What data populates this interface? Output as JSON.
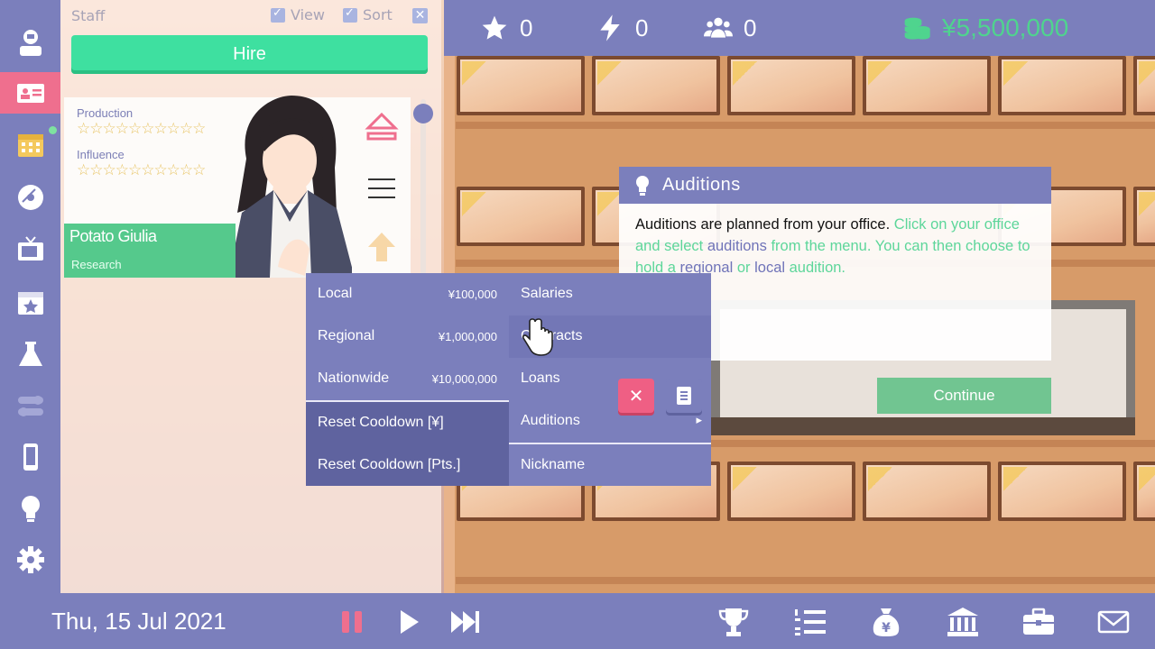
{
  "staff_panel": {
    "title": "Staff",
    "view_label": "View",
    "sort_label": "Sort",
    "close_glyph": "✕",
    "hire_label": "Hire"
  },
  "staff_card": {
    "production_label": "Production",
    "production_stars": "☆☆☆☆☆☆☆☆☆☆",
    "influence_label": "Influence",
    "influence_stars": "☆☆☆☆☆☆☆☆☆☆",
    "name": "Potato Giulia",
    "role": "Research"
  },
  "topbar": {
    "stars": "0",
    "energy": "0",
    "fans": "0",
    "money": "¥5,500,000"
  },
  "audition_menu": {
    "items": [
      {
        "label": "Local",
        "price": "¥100,000"
      },
      {
        "label": "Regional",
        "price": "¥1,000,000"
      },
      {
        "label": "Nationwide",
        "price": "¥10,000,000"
      },
      {
        "label": "Reset Cooldown [¥]"
      },
      {
        "label": "Reset Cooldown [Pts.]"
      }
    ]
  },
  "context_menu": {
    "items": [
      {
        "label": "Salaries"
      },
      {
        "label": "Contracts"
      },
      {
        "label": "Loans"
      },
      {
        "label": "Auditions",
        "arrow": "▸"
      },
      {
        "label": "Nickname"
      }
    ]
  },
  "dialog": {
    "title": "Auditions",
    "text_1": "Auditions are planned from your office.",
    "text_2": " Click on your office and select ",
    "text_3": "auditions",
    "text_4": " from the menu. You can then choose to hold a ",
    "text_5": "regional",
    "text_6": " or ",
    "text_7": "local",
    "text_8": " audition.",
    "continue_label": "Continue",
    "close_glyph": "✕"
  },
  "bottombar": {
    "date": "Thu, 15 Jul 2021"
  },
  "colors": {
    "bar": "#7b7fbc",
    "accent_pink": "#ef6f8e",
    "money_green": "#4fd48e",
    "hire_green": "#3ee0a0"
  }
}
